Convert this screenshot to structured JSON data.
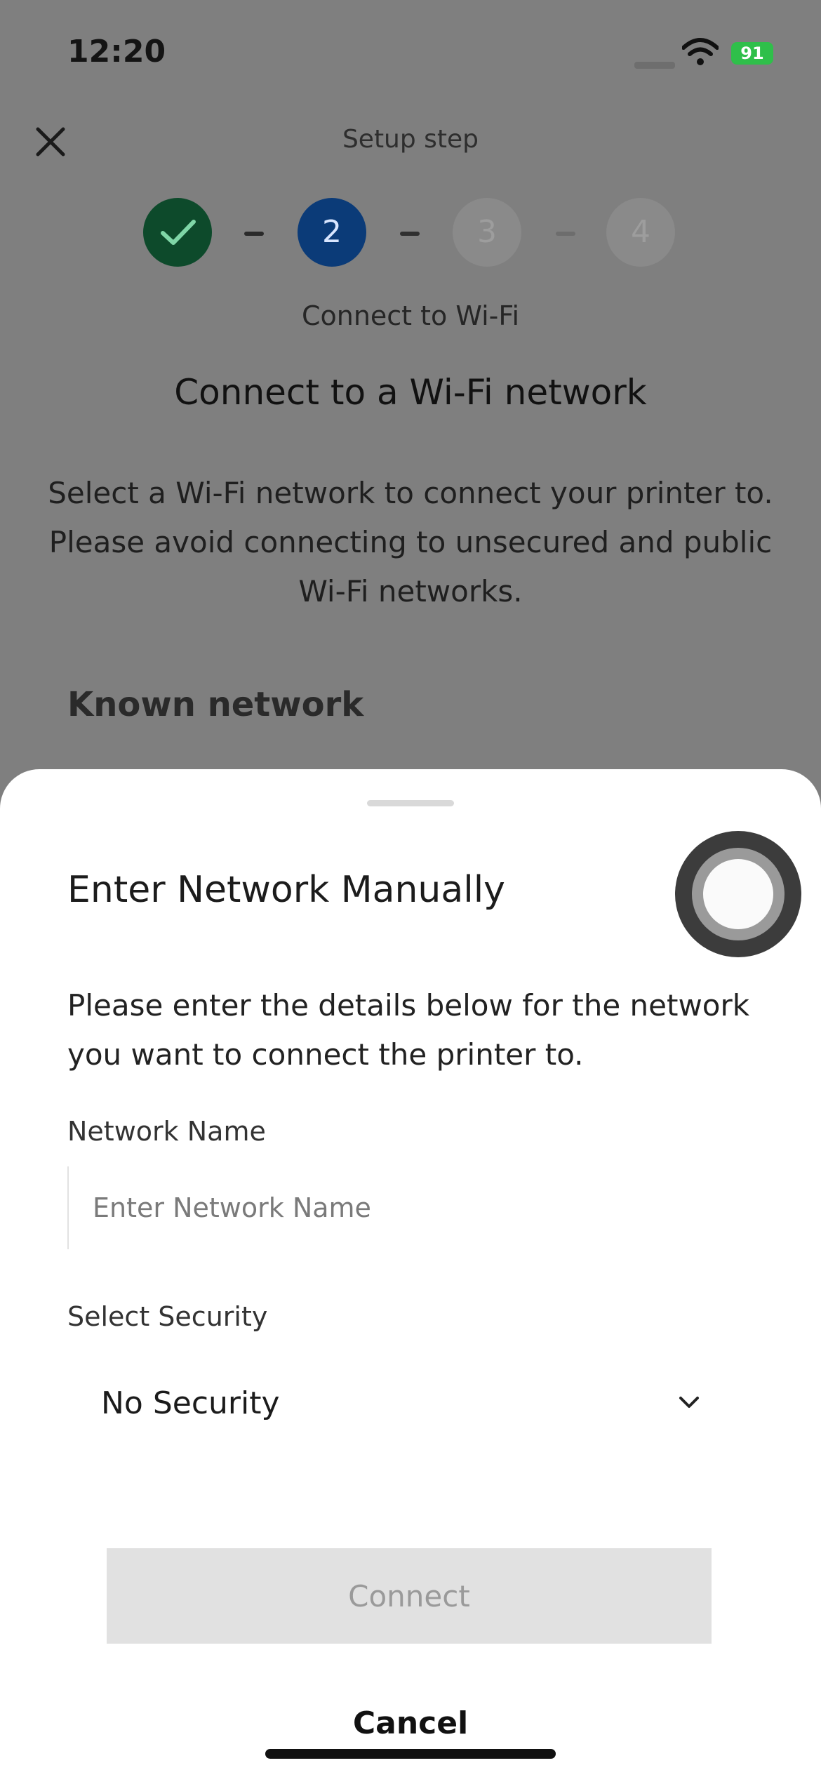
{
  "status": {
    "time": "12:20",
    "battery": "91"
  },
  "header": {
    "setup_step": "Setup step",
    "close_icon": "close-icon"
  },
  "stepper": {
    "steps": [
      "✓",
      "2",
      "3",
      "4"
    ],
    "caption": "Connect to Wi-Fi"
  },
  "page": {
    "heading": "Connect to a Wi-Fi network",
    "description": "Select a Wi-Fi network to connect your printer to. Please avoid connecting to unsecured and public Wi-Fi networks.",
    "known_network": "Known network"
  },
  "sheet": {
    "title": "Enter Network Manually",
    "description": "Please enter the details below for the network you want to connect the printer to.",
    "network_name_label": "Network Name",
    "network_name_value": "",
    "network_name_placeholder": "Enter Network Name",
    "security_label": "Select Security",
    "security_value": "No Security",
    "connect_label": "Connect",
    "cancel_label": "Cancel"
  }
}
